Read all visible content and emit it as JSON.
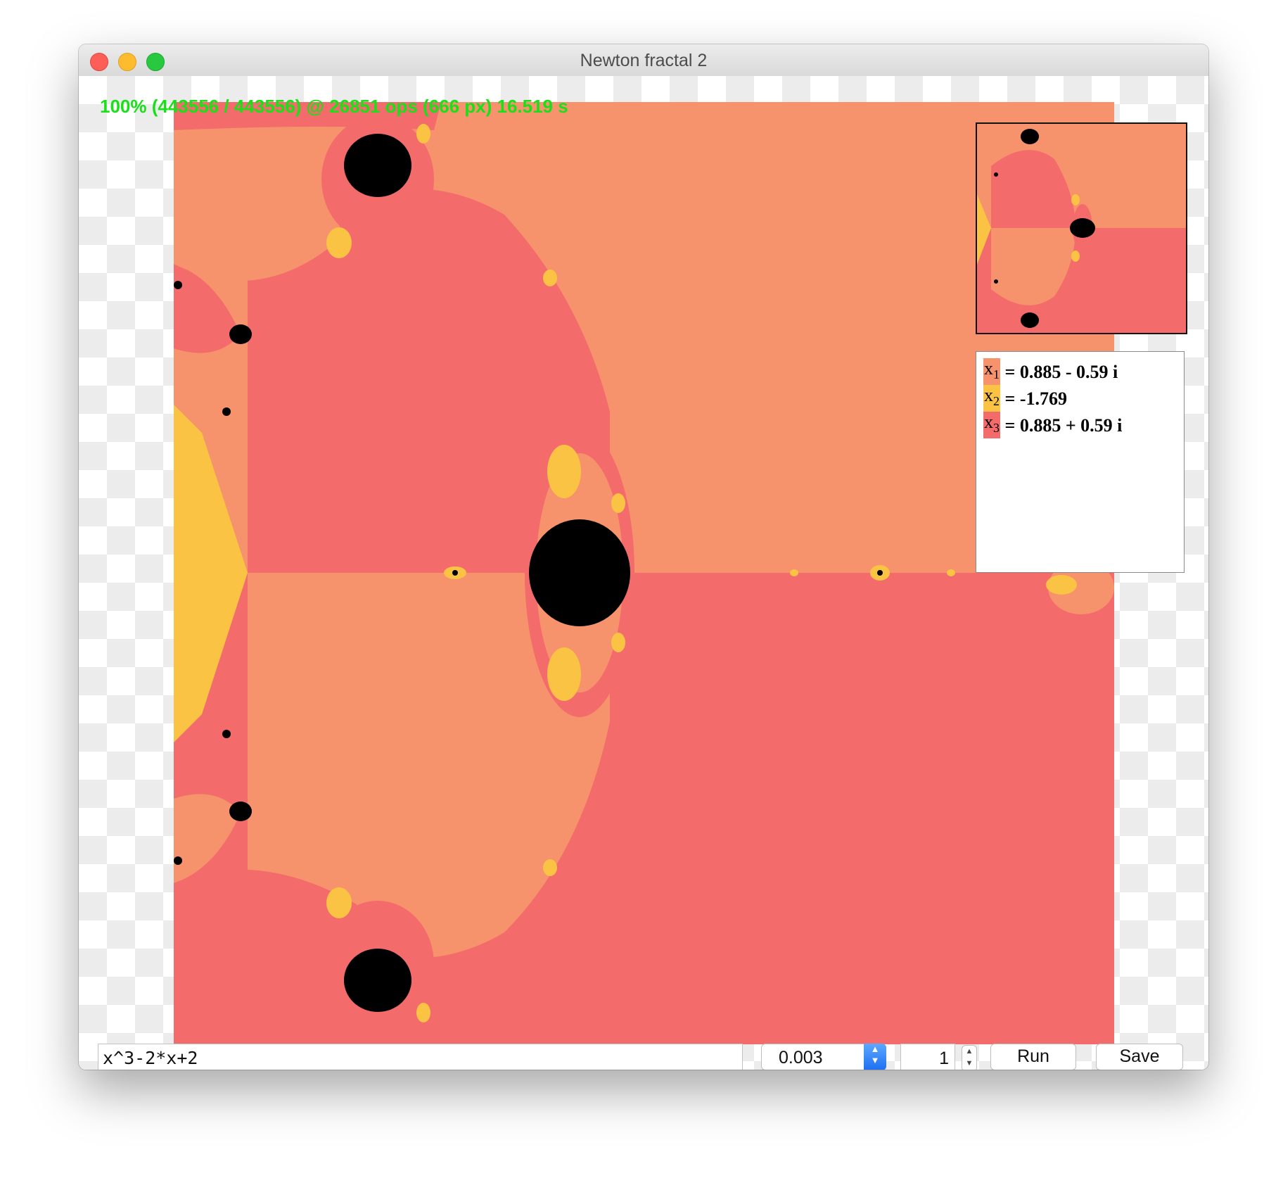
{
  "window": {
    "title": "Newton fractal 2"
  },
  "status": {
    "text": "100% (443556 / 443556) @ 26851 ops (666 px) 16.519 s"
  },
  "colors": {
    "root1": "#f6936c",
    "root2": "#fbc344",
    "root3": "#f46b6b",
    "nonconverge": "#000000",
    "status_text": "#19e019",
    "accent": "#1d6ff2"
  },
  "legend": {
    "roots": [
      {
        "var": "x",
        "sub": "1",
        "text": " = 0.885 - 0.59 i",
        "color": "#f6936c"
      },
      {
        "var": "x",
        "sub": "2",
        "text": " = -1.769",
        "color": "#fbc344"
      },
      {
        "var": "x",
        "sub": "3",
        "text": " = 0.885 + 0.59 i",
        "color": "#f46b6b"
      }
    ]
  },
  "controls": {
    "formula": "x^3-2*x+2",
    "step": "0.003",
    "iterations": "1",
    "run_label": "Run",
    "save_label": "Save"
  },
  "icons": {
    "close": "close-traffic-light-icon",
    "minimize": "minimize-traffic-light-icon",
    "maximize": "maximize-traffic-light-icon",
    "combo": "chevron-updown-icon",
    "stepper": "stepper-updown-icon"
  }
}
